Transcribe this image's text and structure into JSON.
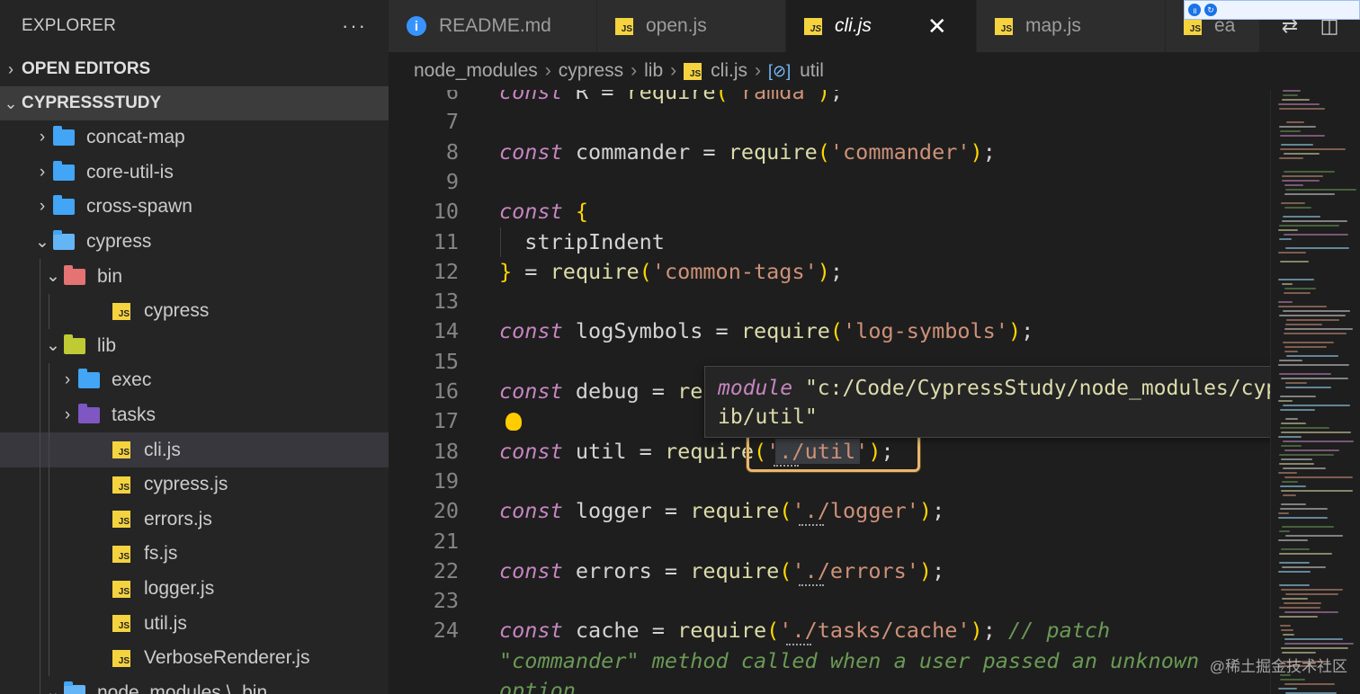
{
  "sidebar": {
    "title": "EXPLORER",
    "more": "···",
    "sections": {
      "open_editors": "OPEN EDITORS",
      "project": "CYPRESSSTUDY"
    },
    "tree": [
      {
        "label": "concat-map",
        "type": "folder",
        "expanded": false,
        "depth": 1
      },
      {
        "label": "core-util-is",
        "type": "folder",
        "expanded": false,
        "depth": 1
      },
      {
        "label": "cross-spawn",
        "type": "folder",
        "expanded": false,
        "depth": 1
      },
      {
        "label": "cypress",
        "type": "folder-open",
        "expanded": true,
        "depth": 1
      },
      {
        "label": "bin",
        "type": "folder-bin",
        "expanded": true,
        "depth": 2
      },
      {
        "label": "cypress",
        "type": "js",
        "depth": 3
      },
      {
        "label": "lib",
        "type": "folder-lib",
        "expanded": true,
        "depth": 2
      },
      {
        "label": "exec",
        "type": "folder",
        "expanded": false,
        "depth": 3
      },
      {
        "label": "tasks",
        "type": "folder-tasks",
        "expanded": false,
        "depth": 3
      },
      {
        "label": "cli.js",
        "type": "js",
        "depth": 3,
        "selected": true
      },
      {
        "label": "cypress.js",
        "type": "js",
        "depth": 3
      },
      {
        "label": "errors.js",
        "type": "js",
        "depth": 3
      },
      {
        "label": "fs.js",
        "type": "js",
        "depth": 3
      },
      {
        "label": "logger.js",
        "type": "js",
        "depth": 3
      },
      {
        "label": "util.js",
        "type": "js",
        "depth": 3
      },
      {
        "label": "VerboseRenderer.js",
        "type": "js",
        "depth": 3
      },
      {
        "label": "node_modules \\ .bin",
        "type": "folder-open",
        "expanded": true,
        "depth": 2
      }
    ]
  },
  "tabs": [
    {
      "label": "README.md",
      "icon": "info-icon",
      "active": false
    },
    {
      "label": "open.js",
      "icon": "js-icon",
      "active": false
    },
    {
      "label": "cli.js",
      "icon": "js-icon",
      "active": true,
      "close": "✕"
    },
    {
      "label": "map.js",
      "icon": "js-icon",
      "active": false
    },
    {
      "label": "ea",
      "icon": "js-icon",
      "active": false
    }
  ],
  "tab_actions": [
    "⇄",
    "◫",
    "···"
  ],
  "breadcrumb": [
    "node_modules",
    "cypress",
    "lib",
    "cli.js",
    "util"
  ],
  "breadcrumb_sep": "›",
  "js_badge": "JS",
  "editor": {
    "lines": [
      {
        "n": "6",
        "tokens": [
          [
            "kw",
            "const"
          ],
          [
            "plain",
            " R = "
          ],
          [
            "fn",
            "require"
          ],
          [
            "brk",
            "("
          ],
          [
            "str",
            "'ramda'"
          ],
          [
            "brk",
            ")"
          ],
          [
            "plain",
            ";"
          ]
        ]
      },
      {
        "n": "7",
        "tokens": []
      },
      {
        "n": "8",
        "tokens": [
          [
            "kw",
            "const"
          ],
          [
            "plain",
            " commander = "
          ],
          [
            "fn",
            "require"
          ],
          [
            "brk",
            "("
          ],
          [
            "str",
            "'commander'"
          ],
          [
            "brk",
            ")"
          ],
          [
            "plain",
            ";"
          ]
        ]
      },
      {
        "n": "9",
        "tokens": []
      },
      {
        "n": "10",
        "tokens": [
          [
            "kw",
            "const"
          ],
          [
            "plain",
            " "
          ],
          [
            "brk",
            "{"
          ]
        ]
      },
      {
        "n": "11",
        "tokens": [
          [
            "plain",
            "  stripIndent"
          ]
        ]
      },
      {
        "n": "12",
        "tokens": [
          [
            "brk",
            "}"
          ],
          [
            "plain",
            " = "
          ],
          [
            "fn",
            "require"
          ],
          [
            "brk",
            "("
          ],
          [
            "str",
            "'common-tags'"
          ],
          [
            "brk",
            ")"
          ],
          [
            "plain",
            ";"
          ]
        ]
      },
      {
        "n": "13",
        "tokens": []
      },
      {
        "n": "14",
        "tokens": [
          [
            "kw",
            "const"
          ],
          [
            "plain",
            " logSymbols = "
          ],
          [
            "fn",
            "require"
          ],
          [
            "brk",
            "("
          ],
          [
            "str",
            "'log-symbols'"
          ],
          [
            "brk",
            ")"
          ],
          [
            "plain",
            ";"
          ]
        ]
      },
      {
        "n": "15",
        "tokens": []
      },
      {
        "n": "16",
        "tokens": [
          [
            "kw",
            "const"
          ],
          [
            "plain",
            " debug = "
          ],
          [
            "fn",
            "re"
          ]
        ]
      },
      {
        "n": "17",
        "tokens": []
      },
      {
        "n": "18",
        "tokens": [
          [
            "kw",
            "const"
          ],
          [
            "plain",
            " util = "
          ],
          [
            "fn",
            "require"
          ],
          [
            "brk",
            "("
          ],
          [
            "str",
            "'./util'"
          ],
          [
            "brk",
            ")"
          ],
          [
            "plain",
            ";"
          ]
        ]
      },
      {
        "n": "19",
        "tokens": []
      },
      {
        "n": "20",
        "tokens": [
          [
            "kw",
            "const"
          ],
          [
            "plain",
            " logger = "
          ],
          [
            "fn",
            "require"
          ],
          [
            "brk",
            "("
          ],
          [
            "str",
            "'./logger'"
          ],
          [
            "brk",
            ")"
          ],
          [
            "plain",
            ";"
          ]
        ]
      },
      {
        "n": "21",
        "tokens": []
      },
      {
        "n": "22",
        "tokens": [
          [
            "kw",
            "const"
          ],
          [
            "plain",
            " errors = "
          ],
          [
            "fn",
            "require"
          ],
          [
            "brk",
            "("
          ],
          [
            "str",
            "'./errors'"
          ],
          [
            "brk",
            ")"
          ],
          [
            "plain",
            ";"
          ]
        ]
      },
      {
        "n": "23",
        "tokens": []
      },
      {
        "n": "24",
        "tokens": [
          [
            "kw",
            "const"
          ],
          [
            "plain",
            " cache = "
          ],
          [
            "fn",
            "require"
          ],
          [
            "brk",
            "("
          ],
          [
            "str",
            "'./tasks/cache'"
          ],
          [
            "brk",
            ")"
          ],
          [
            "plain",
            "; "
          ],
          [
            "cmt",
            "// patch"
          ]
        ]
      }
    ],
    "wrapped": [
      "\"commander\" method called when a user passed an unknown",
      "option"
    ]
  },
  "hover": {
    "keyword": "module",
    "text": "\"c:/Code/CypressStudy/node_modules/cypress/l",
    "text2": "ib/util\""
  },
  "watermark": "@稀土掘金技术社区",
  "colors": {
    "keyword": "#c586c0",
    "string": "#ce9178",
    "function": "#dcdcaa",
    "bracket": "#ffd700",
    "comment": "#6a9955",
    "highlight_box": "#e8b86d"
  }
}
